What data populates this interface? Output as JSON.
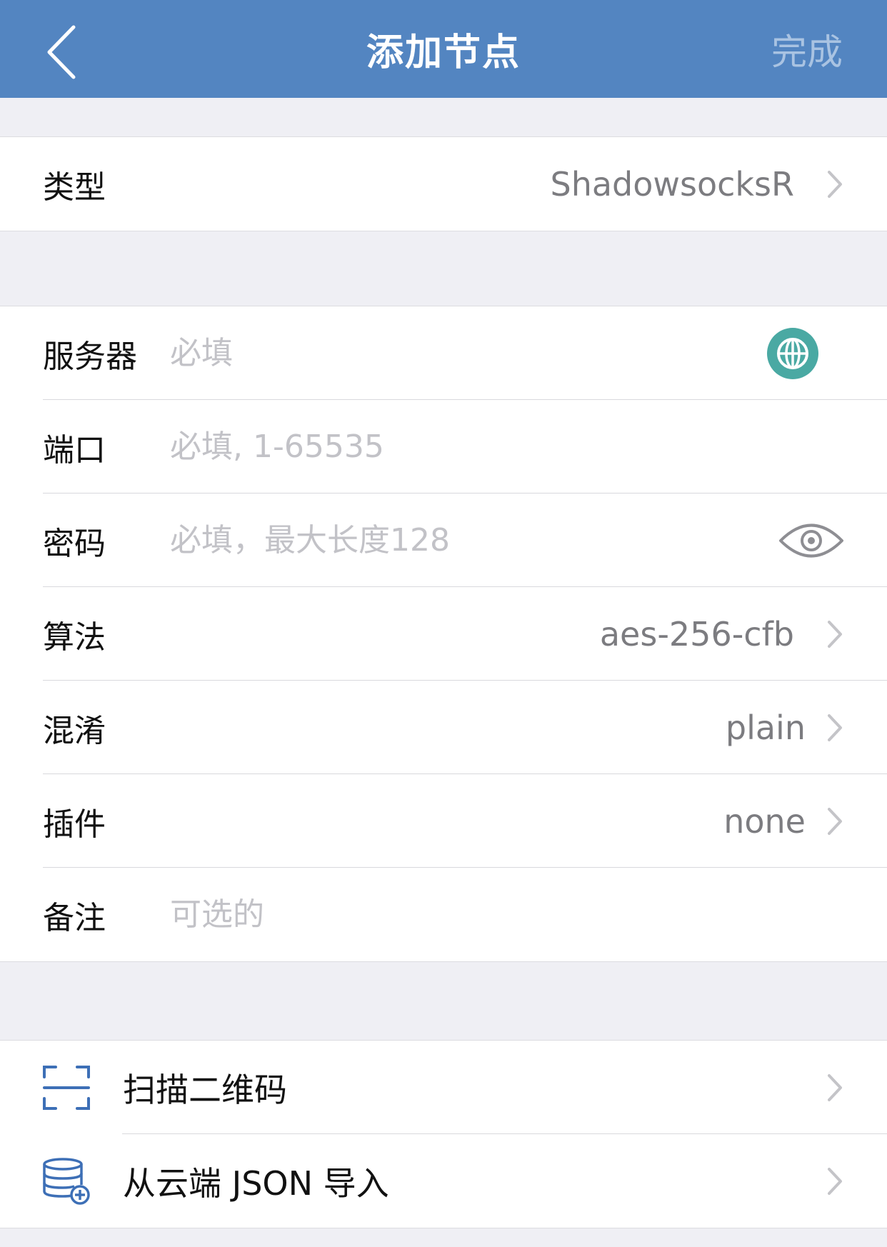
{
  "navbar": {
    "title": "添加节点",
    "done_label": "完成",
    "back_icon": "chevron-left-icon",
    "background": "#5385c1"
  },
  "type_section": {
    "label": "类型",
    "value": "ShadowsocksR"
  },
  "form": {
    "server": {
      "label": "服务器",
      "placeholder": "必填",
      "icon": "globe-icon"
    },
    "port": {
      "label": "端口",
      "placeholder": "必填, 1-65535"
    },
    "password": {
      "label": "密码",
      "placeholder": "必填，最大长度128",
      "icon": "eye-icon"
    },
    "method": {
      "label": "算法",
      "value": "aes-256-cfb"
    },
    "obfs": {
      "label": "混淆",
      "value": "plain"
    },
    "plugin": {
      "label": "插件",
      "value": "none"
    },
    "remark": {
      "label": "备注",
      "placeholder": "可选的"
    }
  },
  "actions": [
    {
      "label": "扫描二维码",
      "icon": "qr-scan-icon"
    },
    {
      "label": "从云端 JSON 导入",
      "icon": "cloud-database-add-icon"
    }
  ],
  "colors": {
    "accent": "#5385c1",
    "globe": "#4aa9a3",
    "placeholder": "#c2c2c7",
    "value": "#7c7c80"
  }
}
